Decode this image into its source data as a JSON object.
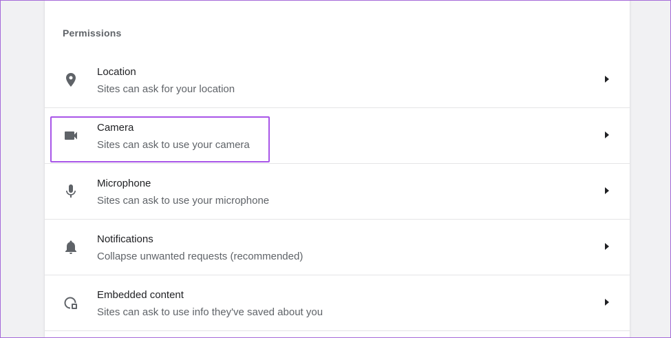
{
  "section": {
    "title": "Permissions"
  },
  "items": [
    {
      "icon": "location-pin-icon",
      "title": "Location",
      "subtitle": "Sites can ask for your location"
    },
    {
      "icon": "camera-icon",
      "title": "Camera",
      "subtitle": "Sites can ask to use your camera"
    },
    {
      "icon": "microphone-icon",
      "title": "Microphone",
      "subtitle": "Sites can ask to use your microphone"
    },
    {
      "icon": "bell-icon",
      "title": "Notifications",
      "subtitle": "Collapse unwanted requests (recommended)"
    },
    {
      "icon": "embedded-content-icon",
      "title": "Embedded content",
      "subtitle": "Sites can ask to use info they've saved about you"
    }
  ],
  "colors": {
    "highlight": "#a855e8",
    "icon": "#5f6368",
    "text_primary": "#202124",
    "text_secondary": "#5f6368"
  }
}
